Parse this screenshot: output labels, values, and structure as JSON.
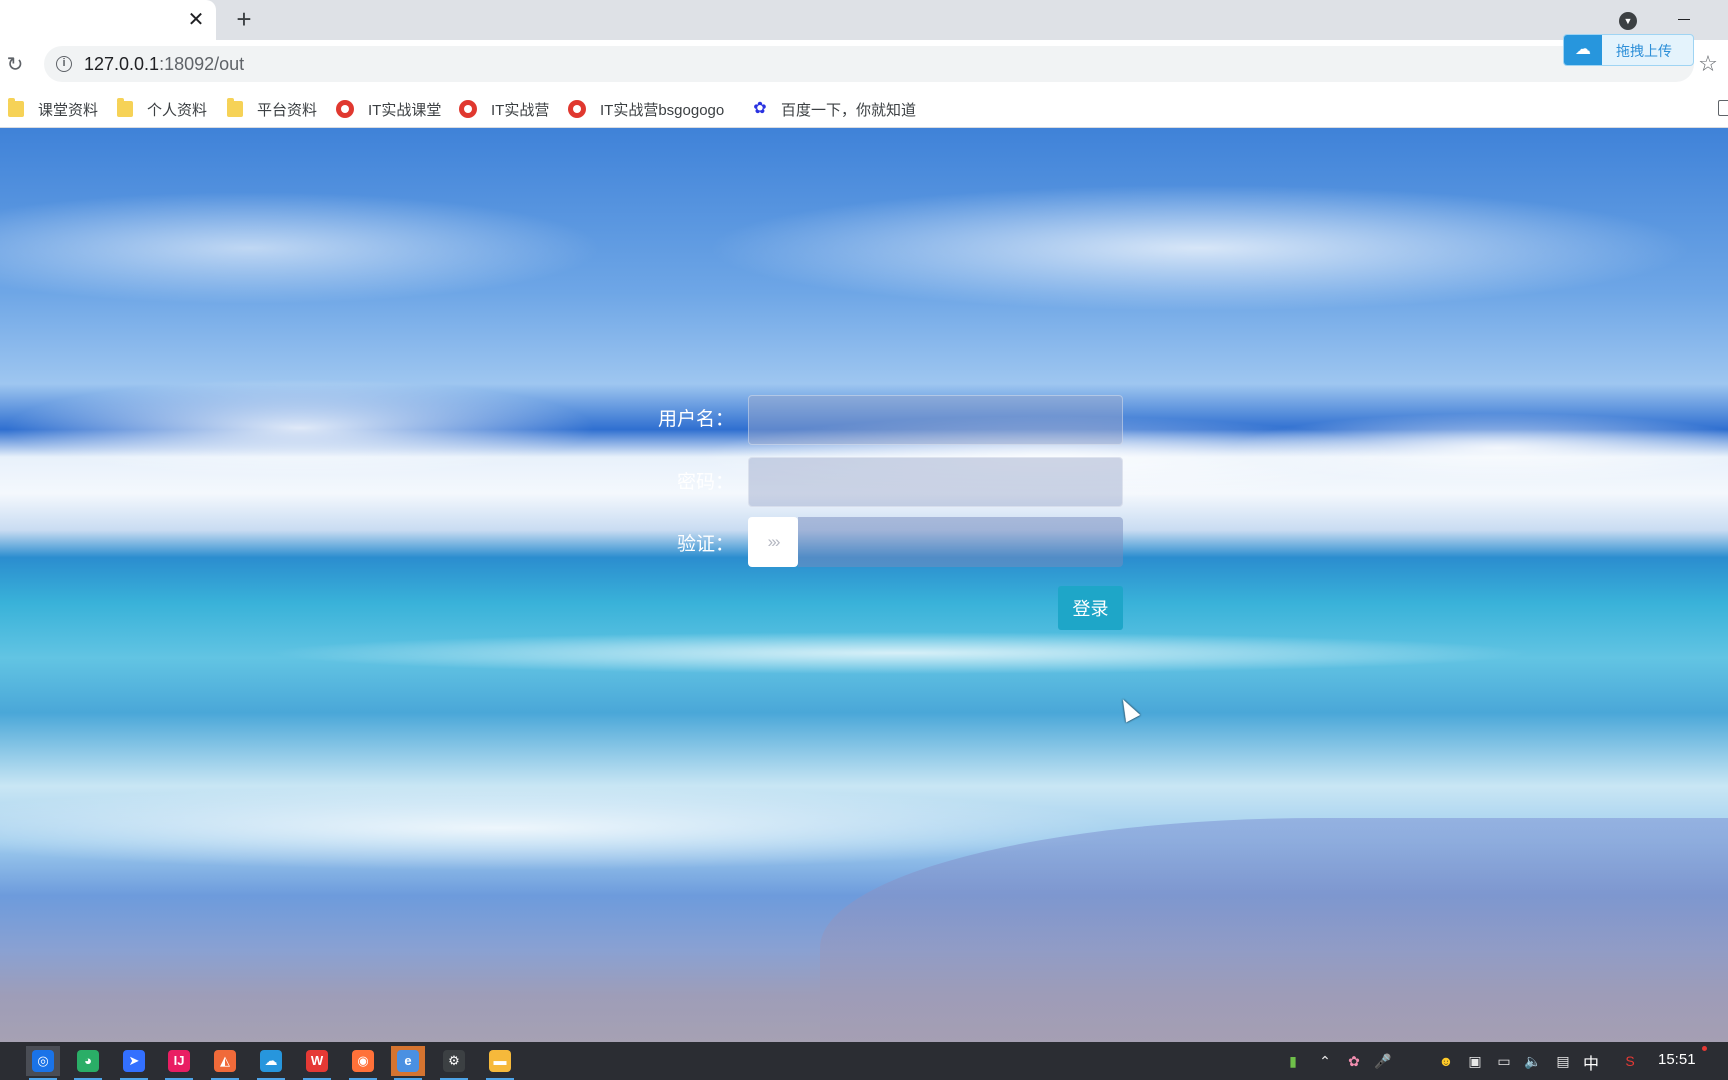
{
  "browser": {
    "tab_close_glyph": "✕",
    "new_tab_glyph": "+",
    "url_host": "127.0.0.1",
    "url_rest": ":18092/out",
    "upload_widget_label": "拖拽上传"
  },
  "bookmarks": [
    {
      "label": "课堂资料",
      "icon": "folder-icon"
    },
    {
      "label": "个人资料",
      "icon": "folder-icon"
    },
    {
      "label": "平台资料",
      "icon": "folder-icon"
    },
    {
      "label": "IT实战课堂",
      "icon": "red-favicon"
    },
    {
      "label": "IT实战营",
      "icon": "red-favicon"
    },
    {
      "label": "IT实战营bsgogogo",
      "icon": "red-favicon"
    },
    {
      "label": "百度一下，你就知道",
      "icon": "baidu-paw-icon"
    }
  ],
  "login_form": {
    "username_label": "用户名：",
    "password_label": "密码：",
    "verify_label": "验证：",
    "slider_handle_glyph": "›››",
    "submit_label": "登录"
  },
  "taskbar": {
    "apps": [
      {
        "name": "chrome-app",
        "glyph": "◎",
        "color": "#1a73e8"
      },
      {
        "name": "wechat-app",
        "glyph": "◕",
        "color": "#2aae67"
      },
      {
        "name": "feishu-app",
        "glyph": "➤",
        "color": "#3370ff"
      },
      {
        "name": "intellij-app",
        "glyph": "IJ",
        "color": "#e91e63"
      },
      {
        "name": "pdf-app",
        "glyph": "◭",
        "color": "#f06a3a"
      },
      {
        "name": "baidu-netdisk-app",
        "glyph": "☁",
        "color": "#2796dd"
      },
      {
        "name": "wps-app",
        "glyph": "W",
        "color": "#e53935"
      },
      {
        "name": "firefox-app",
        "glyph": "◉",
        "color": "#ff7139"
      },
      {
        "name": "browser-app",
        "glyph": "e",
        "color": "#4a90e2"
      },
      {
        "name": "settings-app",
        "glyph": "⚙",
        "color": "#3c4043"
      },
      {
        "name": "file-explorer-app",
        "glyph": "▬",
        "color": "#f6b93b"
      }
    ],
    "ime_label": "中",
    "clock": "15:51"
  }
}
